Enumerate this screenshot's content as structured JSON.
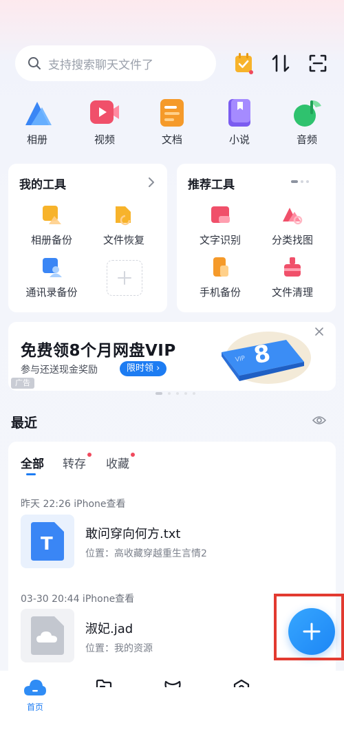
{
  "search": {
    "placeholder": "支持搜索聊天文件了"
  },
  "top_icons": [
    "calendar-check-icon",
    "sort-icon",
    "scan-icon"
  ],
  "categories": [
    {
      "label": "相册",
      "icon": "album-icon",
      "color": "#3a86f5"
    },
    {
      "label": "视频",
      "icon": "video-icon",
      "color": "#f0506a"
    },
    {
      "label": "文档",
      "icon": "document-icon",
      "color": "#f59a2a"
    },
    {
      "label": "小说",
      "icon": "novel-icon",
      "color": "#7b5cf0"
    },
    {
      "label": "音频",
      "icon": "audio-icon",
      "color": "#2fc26e"
    }
  ],
  "my_tools": {
    "title": "我的工具",
    "items": [
      {
        "label": "相册备份",
        "icon": "album-backup-icon"
      },
      {
        "label": "文件恢复",
        "icon": "file-recovery-icon"
      },
      {
        "label": "通讯录备份",
        "icon": "contacts-backup-icon"
      }
    ]
  },
  "recommended_tools": {
    "title": "推荐工具",
    "items": [
      {
        "label": "文字识别",
        "icon": "ocr-icon"
      },
      {
        "label": "分类找图",
        "icon": "classify-image-icon"
      },
      {
        "label": "手机备份",
        "icon": "phone-backup-icon"
      },
      {
        "label": "文件清理",
        "icon": "file-clean-icon"
      }
    ]
  },
  "ad": {
    "title": "免费领8个月网盘VIP",
    "subtitle": "参与还送现金奖励",
    "badge": "限时领",
    "tag": "广告"
  },
  "recent": {
    "title": "最近",
    "tabs": [
      {
        "label": "全部",
        "active": true
      },
      {
        "label": "转存",
        "has_dot": true
      },
      {
        "label": "收藏",
        "has_dot": true
      }
    ],
    "groups": [
      {
        "time": "昨天 22:26 iPhone查看",
        "file": {
          "name": "敢问穿向何方.txt",
          "location": "位置：高收藏穿越重生言情2",
          "thumb_letter": "T"
        }
      },
      {
        "time": "03-30 20:44 iPhone查看",
        "file": {
          "name": "淑妃.jad",
          "location": "位置：我的资源"
        }
      }
    ]
  },
  "bottom_nav": [
    {
      "label": "首页",
      "icon": "home-cloud-icon",
      "active": true
    },
    {
      "label": "",
      "icon": "file-icon"
    },
    {
      "label": "",
      "icon": "share-icon"
    },
    {
      "label": "",
      "icon": "discover-icon"
    }
  ],
  "colors": {
    "accent": "#1d7cf2",
    "highlight_border": "#e23a30",
    "dot": "#f04a5d"
  }
}
